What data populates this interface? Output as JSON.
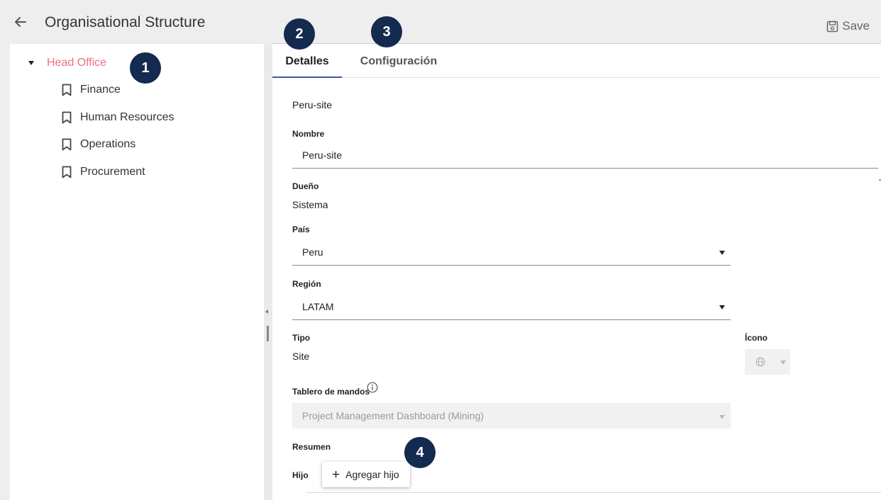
{
  "header": {
    "title": "Organisational Structure",
    "save_label": "Save"
  },
  "tree": {
    "root": "Head Office",
    "children": [
      "Finance",
      "Human Resources",
      "Operations",
      "Procurement"
    ]
  },
  "tabs": [
    "Detalles",
    "Configuración"
  ],
  "badges": [
    "1",
    "2",
    "3",
    "4"
  ],
  "form": {
    "record_name": "Peru-site",
    "nombre_label": "Nombre",
    "nombre_value": "Peru-site",
    "dueno_label": "Dueño",
    "dueno_value": "Sistema",
    "pais_label": "País",
    "pais_value": "Peru",
    "region_label": "Región",
    "region_value": "LATAM",
    "tipo_label": "Tipo",
    "tipo_value": "Site",
    "icono_label": "Ícono",
    "tablero_label": "Tablero de mandos",
    "tablero_value": "Project Management Dashboard (Mining)",
    "resumen_label": "Resumen",
    "hijo_label": "Hijo",
    "add_child_label": "Agregar hijo"
  },
  "icons": [
    "arrow-back-icon",
    "caret-down-icon",
    "bookmark-icon",
    "save-icon",
    "globe-icon",
    "info-icon",
    "plus-icon"
  ],
  "colors": {
    "accent": "#3a5a9c",
    "root_highlight": "#f07080",
    "badge": "#142a4e"
  }
}
